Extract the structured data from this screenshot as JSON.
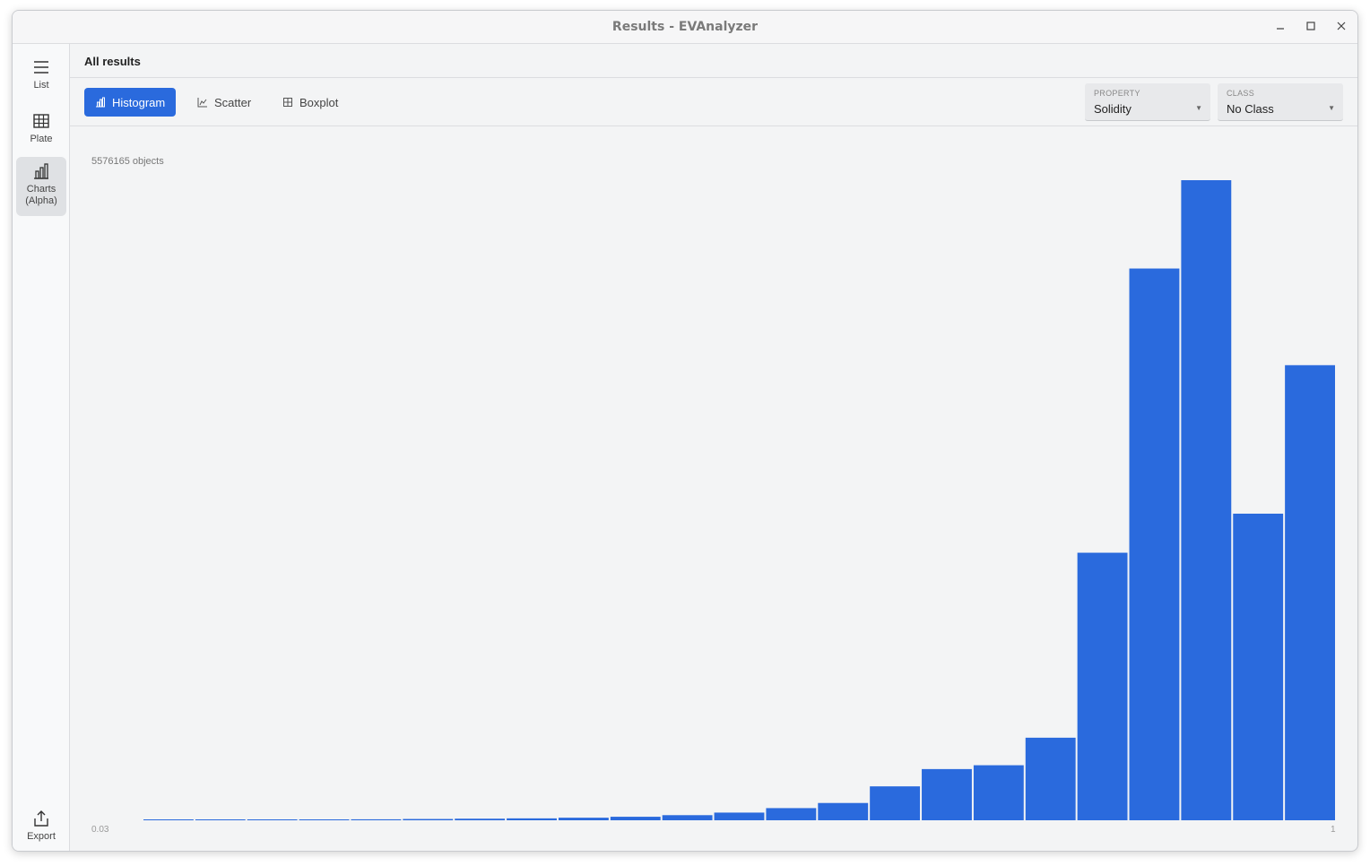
{
  "window": {
    "title": "Results - EVAnalyzer"
  },
  "rail": {
    "items": [
      {
        "label": "List",
        "icon": "menu-icon"
      },
      {
        "label": "Plate",
        "icon": "grid-icon"
      },
      {
        "label": "Charts\n(Alpha)",
        "icon": "bar-chart-icon"
      }
    ],
    "export_label": "Export"
  },
  "header": {
    "title": "All results"
  },
  "toolbar": {
    "tabs": [
      {
        "label": "Histogram",
        "active": true
      },
      {
        "label": "Scatter",
        "active": false
      },
      {
        "label": "Boxplot",
        "active": false
      }
    ],
    "property": {
      "caption": "PROPERTY",
      "value": "Solidity"
    },
    "class": {
      "caption": "CLASS",
      "value": "No Class"
    }
  },
  "colors": {
    "accent": "#2a6add",
    "bar": "#2a6add"
  },
  "chart_data": {
    "type": "bar",
    "count_label": "5576165 objects",
    "x_min_label": "0.03",
    "x_max_label": "1",
    "xlim": [
      0.03,
      1
    ],
    "bins": 23,
    "values_relative": [
      0.0005,
      0.0007,
      0.001,
      0.0012,
      0.0015,
      0.002,
      0.0025,
      0.003,
      0.004,
      0.0055,
      0.008,
      0.012,
      0.019,
      0.027,
      0.053,
      0.08,
      0.086,
      0.129,
      0.418,
      0.862,
      1.0,
      0.479,
      0.711
    ],
    "grid": false,
    "legend": false
  }
}
